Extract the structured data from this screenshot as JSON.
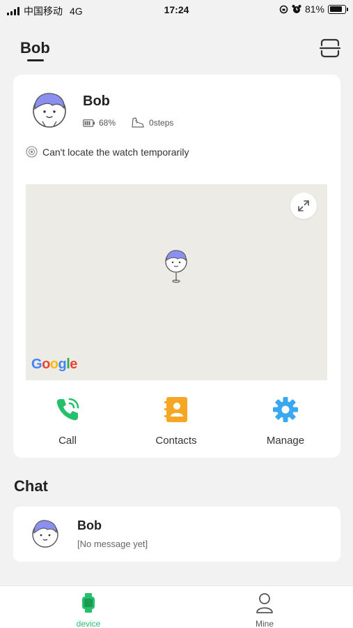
{
  "status_bar": {
    "carrier": "中国移动",
    "network": "4G",
    "time": "17:24",
    "battery": "81%",
    "battery_level": 0.81
  },
  "header": {
    "title": "Bob"
  },
  "device": {
    "name": "Bob",
    "battery": "68%",
    "steps": "0steps",
    "location_status": "Can't locate the watch temporarily",
    "map_attribution": "Google"
  },
  "actions": [
    {
      "label": "Call",
      "icon": "phone-icon",
      "color": "#27c06a"
    },
    {
      "label": "Contacts",
      "icon": "contacts-book-icon",
      "color": "#f5a623"
    },
    {
      "label": "Manage",
      "icon": "gear-icon",
      "color": "#3aa8f0"
    }
  ],
  "chat": {
    "section_title": "Chat",
    "items": [
      {
        "name": "Bob",
        "last_message": "[No message yet]"
      }
    ]
  },
  "tabbar": {
    "tabs": [
      {
        "label": "device",
        "active": true,
        "color": "#27c06a"
      },
      {
        "label": "Mine",
        "active": false,
        "color": "#555555"
      }
    ]
  }
}
